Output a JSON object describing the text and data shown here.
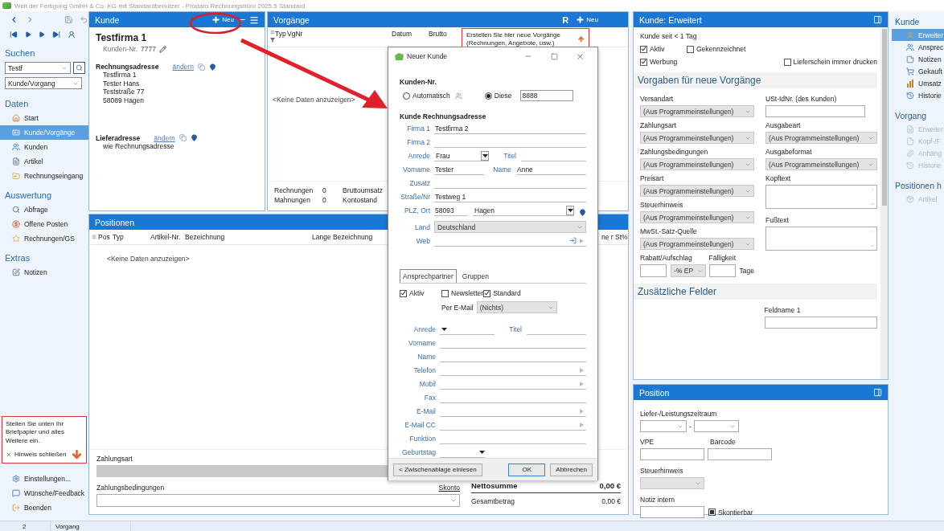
{
  "window": {
    "title": "Welt der Fertigung GmbH & Co. KG mit Standardbenutzer  -  Prodaro Rechnungsbüro 2025.5 Standard"
  },
  "sidebar": {
    "search_title": "Suchen",
    "search_value": "Testf",
    "scope": "Kunde/Vorgang",
    "sections": [
      {
        "title": "Daten",
        "items": [
          {
            "label": "Start",
            "selected": false
          },
          {
            "label": "Kunde/Vorgänge",
            "selected": true
          },
          {
            "label": "Kunden",
            "selected": false
          },
          {
            "label": "Artikel",
            "selected": false
          },
          {
            "label": "Rechnungseingang",
            "selected": false
          }
        ]
      },
      {
        "title": "Auswertung",
        "items": [
          {
            "label": "Abfrage",
            "selected": false
          },
          {
            "label": "Offene Posten",
            "selected": false
          },
          {
            "label": "Rechnungen/GS",
            "selected": false
          }
        ]
      },
      {
        "title": "Extras",
        "items": [
          {
            "label": "Notizen",
            "selected": false
          }
        ]
      }
    ],
    "hint": {
      "text": "Stellen Sie unten Ihr Briefpapier und alles Weitere ein.",
      "close": "Hinweis schließen"
    },
    "footer": [
      "Einstellungen...",
      "Wünsche/Feedback",
      "Beenden"
    ]
  },
  "customer": {
    "title": "Kunde",
    "new_button": "Neu",
    "company": "Testfirma 1",
    "number_label": "Kunden-Nr.",
    "number": "7777",
    "addresses": [
      {
        "label": "Rechnungsadresse",
        "link": "ändern",
        "lines": [
          "Testfirma 1",
          "Tester Hans",
          "Teststraße 77",
          "58089 Hagen"
        ]
      },
      {
        "label": "Lieferadresse",
        "link": "ändern",
        "lines": [
          "wie Rechnungsadresse"
        ]
      }
    ]
  },
  "documents": {
    "title": "Vorgänge",
    "r_button": "R",
    "new_button": "Neu",
    "columns": [
      "Typ",
      "VgNr",
      "Datum",
      "Brutto"
    ],
    "empty": "<Keine Daten anzuzeigen>",
    "hint": "Erstellen Sie hier neue Vorgänge (Rechnungen, Angebote, usw.)",
    "counts": [
      {
        "label": "Rechnungen",
        "value": "0"
      },
      {
        "label": "Mahnungen",
        "value": "0"
      }
    ],
    "sums": [
      "Bruttoumsatz",
      "Kontostand"
    ]
  },
  "positions": {
    "title": "Positionen",
    "columns": [
      "Pos",
      "Typ",
      "Artikel-Nr.",
      "Bezeichnung",
      "Lange Bezeichnung",
      "ne r",
      "St%"
    ],
    "empty": "<Keine Daten anzuzeigen>",
    "payment_label": "Zahlungsart",
    "terms_label": "Zahlungsbedingungen",
    "discount_link": "Skonto",
    "totals": [
      {
        "label": "Nettosumme",
        "value": "0,00 €",
        "bold": true
      },
      {
        "label": "Gesamtbetrag",
        "value": "0,00 €",
        "bold": false
      }
    ]
  },
  "dialog": {
    "title": "Neuer Kunde",
    "number_title": "Kunden-Nr.",
    "number_options": [
      {
        "label": "Automatisch",
        "selected": false
      },
      {
        "label": "Diese",
        "selected": true
      }
    ],
    "number_value": "8888",
    "address_title": "Kunde Rechnungsadresse",
    "address_fields": [
      {
        "kind": "text",
        "label": "Firma 1",
        "value": "Testfirma 2"
      },
      {
        "kind": "text",
        "label": "Firma 2"
      },
      {
        "kind": "select_pair",
        "label": "Anrede",
        "value": "Frau",
        "label2": "Titel"
      },
      {
        "kind": "pair",
        "label": "Vorname",
        "value": "Tester",
        "label2": "Name",
        "value2": "Anne"
      },
      {
        "kind": "text",
        "label": "Zusatz"
      },
      {
        "kind": "text",
        "label": "Straße/Nr",
        "value": "Testweg 1"
      },
      {
        "kind": "zip_city",
        "label": "PLZ, Ort",
        "value": "58093",
        "value2": "Hagen"
      },
      {
        "kind": "country",
        "label": "Land",
        "value": "Deutschland"
      },
      {
        "kind": "web",
        "label": "Web"
      }
    ],
    "tabs": [
      {
        "label": "Ansprechpartner",
        "selected": true
      },
      {
        "label": "Gruppen",
        "selected": false
      }
    ],
    "flags": [
      {
        "label": "Aktiv",
        "checked": true
      },
      {
        "label": "Newsletter",
        "checked": false
      },
      {
        "label": "Standard",
        "checked": true
      }
    ],
    "email_label": "Per E-Mail",
    "email_value": "(Nichts)",
    "contact_fields": [
      {
        "kind": "select_pair",
        "label": "Anrede",
        "label2": "Titel"
      },
      {
        "kind": "text",
        "label": "Vorname"
      },
      {
        "kind": "text",
        "label": "Name"
      },
      {
        "kind": "action",
        "label": "Telefon"
      },
      {
        "kind": "action",
        "label": "Mobil"
      },
      {
        "kind": "text",
        "label": "Fax"
      },
      {
        "kind": "action",
        "label": "E-Mail"
      },
      {
        "kind": "action",
        "label": "E-Mail CC"
      },
      {
        "kind": "text",
        "label": "Funktion"
      },
      {
        "kind": "date",
        "label": "Geburtstag"
      }
    ],
    "left_button": "< Zwischenablage einlesen",
    "buttons": [
      {
        "label": "OK",
        "default": true
      },
      {
        "label": "Abbrechen",
        "default": false
      }
    ]
  },
  "extended": {
    "title": "Kunde: Erweitert",
    "since": "Kunde seit < 1 Tag",
    "flags": [
      {
        "label": "Aktiv",
        "checked": true
      },
      {
        "label": "Gekennzeichnet",
        "checked": false
      },
      {
        "label": "Werbung",
        "checked": true
      },
      {
        "label": "Lieferschein immer drucken",
        "checked": false
      }
    ],
    "defaults_title": "Vorgaben für neue Vorgänge",
    "left_fields": [
      {
        "label": "Versandart",
        "value": "(Aus Programmeinstellungen)"
      },
      {
        "label": "Zahlungsart",
        "value": "(Aus Programmeinstellungen)"
      },
      {
        "label": "Zahlungsbedingungen",
        "value": "(Aus Programmeinstellungen)"
      },
      {
        "label": "Preisart",
        "value": "(Aus Programmeinstellungen)"
      },
      {
        "label": "Steuerhinweis",
        "value": "(Aus Programmeinstellungen)"
      },
      {
        "label": "MwSt.-Satz-Quelle",
        "value": "(Aus Programmeinstellungen)"
      }
    ],
    "right_fields": [
      {
        "kind": "input",
        "label": "USt-IdNr. (des Kunden)"
      },
      {
        "kind": "select",
        "label": "Ausgabeart",
        "value": "(Aus Programmeinstellungen)"
      },
      {
        "kind": "select",
        "label": "Ausgabeformat",
        "value": "(Aus Programmeinstellungen)"
      },
      {
        "kind": "textarea",
        "label": "Kopftext"
      },
      {
        "kind": "textarea",
        "label": "Fußtext"
      }
    ],
    "discount_label": "Rabatt/Aufschlag",
    "discount_unit": "-% EP",
    "due_label": "Fälligkeit",
    "due_unit": "Tage",
    "extra_title": "Zusätzliche Felder",
    "extra_fields": [
      "Feldname 1"
    ]
  },
  "position": {
    "title": "Position",
    "period_label": "Liefer-/Leistungszeitraum",
    "period_separator": "-",
    "vpe_label": "VPE",
    "barcode_label": "Barcode",
    "tax_label": "Steuerhinweis",
    "note_label": "Notiz intern",
    "discountable": {
      "label": "Skontierbar",
      "checked": true
    }
  },
  "nav": {
    "sections": [
      {
        "title": "Kunde",
        "items": [
          {
            "label": "Erweiter",
            "selected": true,
            "disabled": false
          },
          {
            "label": "Ansprec",
            "selected": false,
            "disabled": false
          },
          {
            "label": "Notizen",
            "selected": false,
            "disabled": false
          },
          {
            "label": "Gekauft",
            "selected": false,
            "disabled": false
          },
          {
            "label": "Umsatz",
            "selected": false,
            "disabled": false
          },
          {
            "label": "Historie",
            "selected": false,
            "disabled": false
          }
        ]
      },
      {
        "title": "Vorgang",
        "items": [
          {
            "label": "Erweiter",
            "selected": false,
            "disabled": true
          },
          {
            "label": "Kopf-/F",
            "selected": false,
            "disabled": true
          },
          {
            "label": "Anhäng",
            "selected": false,
            "disabled": true
          },
          {
            "label": "Historie",
            "selected": false,
            "disabled": true
          }
        ]
      },
      {
        "title": "Positionen h",
        "items": [
          {
            "label": "Artikel",
            "selected": false,
            "disabled": true
          }
        ]
      }
    ]
  },
  "status_bar": [
    "2",
    "Vorgang"
  ]
}
